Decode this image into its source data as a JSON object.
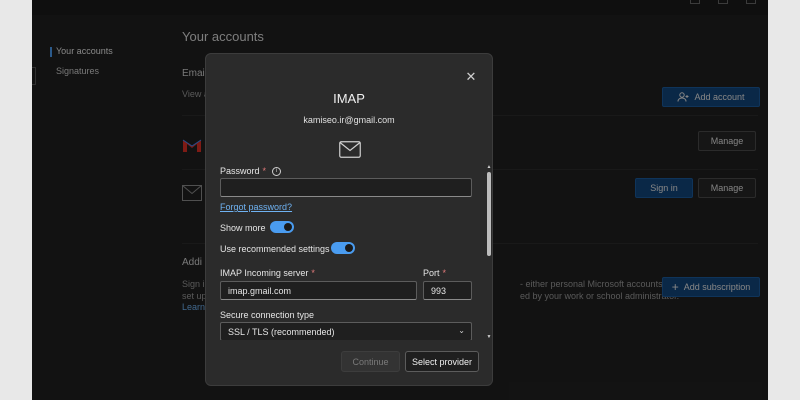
{
  "sidebar": {
    "items": [
      {
        "label": "Your accounts",
        "active": true
      },
      {
        "label": "Signatures",
        "active": false
      }
    ]
  },
  "main": {
    "title": "Your accounts",
    "email_section_fragment": "Emai",
    "view_fragment": "View a",
    "add_account_label": "Add account",
    "manage_label": "Manage",
    "sign_in_label": "Sign in",
    "add_section_fragment": "Addi",
    "sign_fragment": "Sign i",
    "setup_fragment": "set up",
    "learn_fragment": "Learn",
    "subscription_line1": "- either personal Microsoft accounts",
    "subscription_line2": "ed by your work or school administrator.",
    "add_subscription_label": "Add subscription"
  },
  "dialog": {
    "title": "IMAP",
    "email": "kamiseo.ir@gmail.com",
    "password_label": "Password",
    "required_mark": "*",
    "info_glyph": "i",
    "password_value": "",
    "forgot_password": "Forgot password?",
    "show_more_label": "Show more",
    "show_more_on": true,
    "use_recommended_label": "Use recommended settings",
    "use_recommended_on": true,
    "imap_server_label": "IMAP Incoming server",
    "imap_server_value": "imap.gmail.com",
    "port_label": "Port",
    "port_value": "993",
    "secure_label": "Secure connection type",
    "secure_value": "SSL / TLS (recommended)",
    "continue_label": "Continue",
    "select_provider_label": "Select provider"
  },
  "icons": {
    "close": "close-icon",
    "mail": "mail-icon",
    "info": "info-icon",
    "chevron": "chevron-down-icon",
    "add_user": "add-user-icon",
    "plus": "plus-icon"
  },
  "colors": {
    "accent": "#4a9cf0",
    "primary_button": "#12457a",
    "link": "#6fb2f2",
    "required": "#e37a7a"
  }
}
